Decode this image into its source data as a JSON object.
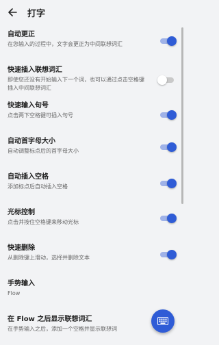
{
  "header": {
    "title": "打字",
    "back_icon": "arrow-left-icon"
  },
  "colors": {
    "accent": "#2f5cd6",
    "track_on": "#9fb2e8",
    "background": "#f2f3f5"
  },
  "settings": [
    {
      "title": "自动更正",
      "desc": "在您输入的过程中，文字会更正为中间联想词汇",
      "on": true
    },
    {
      "title": "快速插入联想词汇",
      "desc": "即使您还没有开始输入下一个词，也可以通过点击空格键插入中间联想词汇",
      "on": false
    },
    {
      "title": "快速输入句号",
      "desc": "点击两下空格键可插入句号",
      "on": true
    },
    {
      "title": "自动首字母大小",
      "desc": "自动调整标点后的首字母大小",
      "on": true
    },
    {
      "title": "自动插入空格",
      "desc": "添加标点后自动插入空格",
      "on": true
    },
    {
      "title": "光标控制",
      "desc": "点击并按住空格键来移动光标",
      "on": true
    },
    {
      "title": "快速删除",
      "desc": "从删除键上滑动，选择并删除文本",
      "on": true
    },
    {
      "title": "手势输入",
      "desc": "Flow"
    },
    {
      "title": "在 Flow 之后显示联想词汇",
      "desc": "在手势输入之后，添加一个空格并显示联想词"
    }
  ],
  "fab": {
    "icon": "keyboard-icon"
  }
}
